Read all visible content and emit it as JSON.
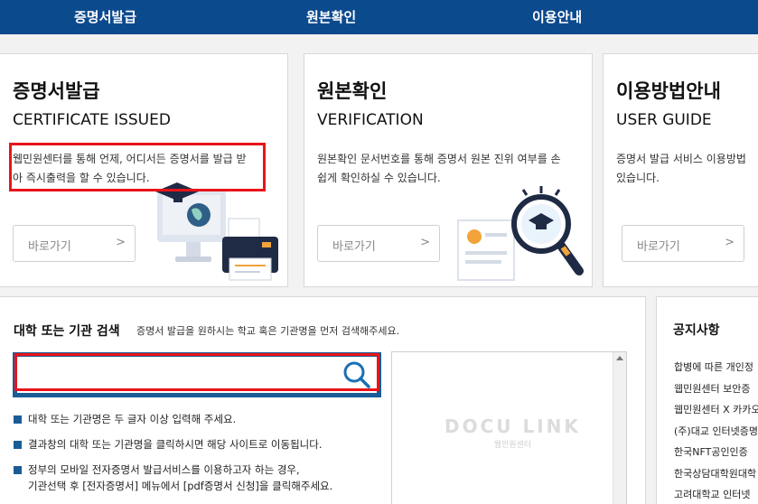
{
  "nav": {
    "items": [
      "증명서발급",
      "원본확인",
      "이용안내"
    ]
  },
  "cards": {
    "issue": {
      "title": "증명서발급",
      "subtitle": "CERTIFICATE ISSUED",
      "desc": [
        "웹민원센터를 통해 언제, 어디서든 증명서를 발급 받",
        "아 즉시출력을 할 수 있습니다."
      ],
      "button": "바로가기",
      "button_arrow": ">"
    },
    "verify": {
      "title": "원본확인",
      "subtitle": "VERIFICATION",
      "desc": [
        "원본확인 문서번호를 통해 증명서 원본 진위 여부를 손",
        "쉽게 확인하실 수 있습니다."
      ],
      "button": "바로가기",
      "button_arrow": ">"
    },
    "guide": {
      "title": "이용방법안내",
      "subtitle": "USER GUIDE",
      "desc": [
        "증명서 발급 서비스 이용방법",
        "있습니다."
      ],
      "button": "바로가기",
      "button_arrow": ">"
    }
  },
  "search": {
    "title": "대학 또는 기관 검색",
    "hint": "증명서 발급을 원하시는 학교 혹은 기관명을 먼저 검색해주세요.",
    "value": "",
    "placeholder": "",
    "bullets": [
      [
        "대학 또는 기관명은 두 글자 이상 입력해 주세요."
      ],
      [
        "결과창의 대학 또는 기관명을 클릭하시면 해당 사이트로 이동됩니다."
      ],
      [
        "정부의 모바일 전자증명서 발급서비스를 이용하고자 하는 경우,",
        "기관선택 후 [전자증명서] 메뉴에서 [pdf증명서 신청]을 클릭해주세요."
      ]
    ],
    "watermark_logo": "DOCU LINK",
    "watermark_sub": "웹민원센터"
  },
  "notice": {
    "title": "공지사항",
    "items": [
      "합병에 따른 개인정",
      "웹민원센터 보안증",
      "웹민원센터 X 카카오",
      "(주)대교 인터넷증명",
      "한국NFT공인인증",
      "한국상담대학원대학",
      "고려대학교 인터넷"
    ]
  },
  "colors": {
    "nav_bg": "#0c4a8e",
    "highlight": "#e8141b",
    "search_border": "#1a5c96"
  }
}
